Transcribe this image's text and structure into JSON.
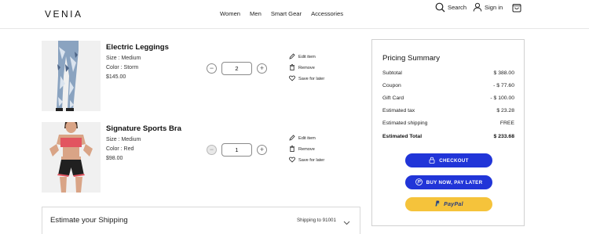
{
  "header": {
    "logo": "VENIA",
    "nav": [
      "Women",
      "Men",
      "Smart Gear",
      "Accessories"
    ],
    "search_label": "Search",
    "signin_label": "Sign in"
  },
  "cart": {
    "items": [
      {
        "name": "Electric Leggings",
        "size": "Size : Medium",
        "color": "Color : Storm",
        "price": "$145.00",
        "quantity": "2",
        "decrement_disabled": false,
        "actions": [
          "Edit item",
          "Remove",
          "Save for later"
        ]
      },
      {
        "name": "Signature Sports Bra",
        "size": "Size : Medium",
        "color": "Color : Red",
        "price": "$98.00",
        "quantity": "1",
        "decrement_disabled": true,
        "actions": [
          "Edit item",
          "Remove",
          "Save for later"
        ]
      }
    ]
  },
  "shipping": {
    "title": "Estimate your Shipping",
    "ship_to": "Shipping to 91001"
  },
  "summary": {
    "title": "Pricing Summary",
    "rows": [
      {
        "label": "Subtotal",
        "value": "$ 388.00"
      },
      {
        "label": "Coupon",
        "value": "- $ 77.60"
      },
      {
        "label": "Gift Card",
        "value": "- $ 100.00"
      },
      {
        "label": "Estimated tax",
        "value": "$ 23.28"
      },
      {
        "label": "Estimated shipping",
        "value": "FREE"
      },
      {
        "label": "Estimated Total",
        "value": "$ 233.68"
      }
    ],
    "checkout_label": "CHECKOUT",
    "bnpl_label": "BUY NOW, PAY LATER",
    "paypal_label": "PayPal"
  },
  "colors": {
    "accent_blue": "#2135d8",
    "paypal_yellow": "#f5c33b"
  }
}
